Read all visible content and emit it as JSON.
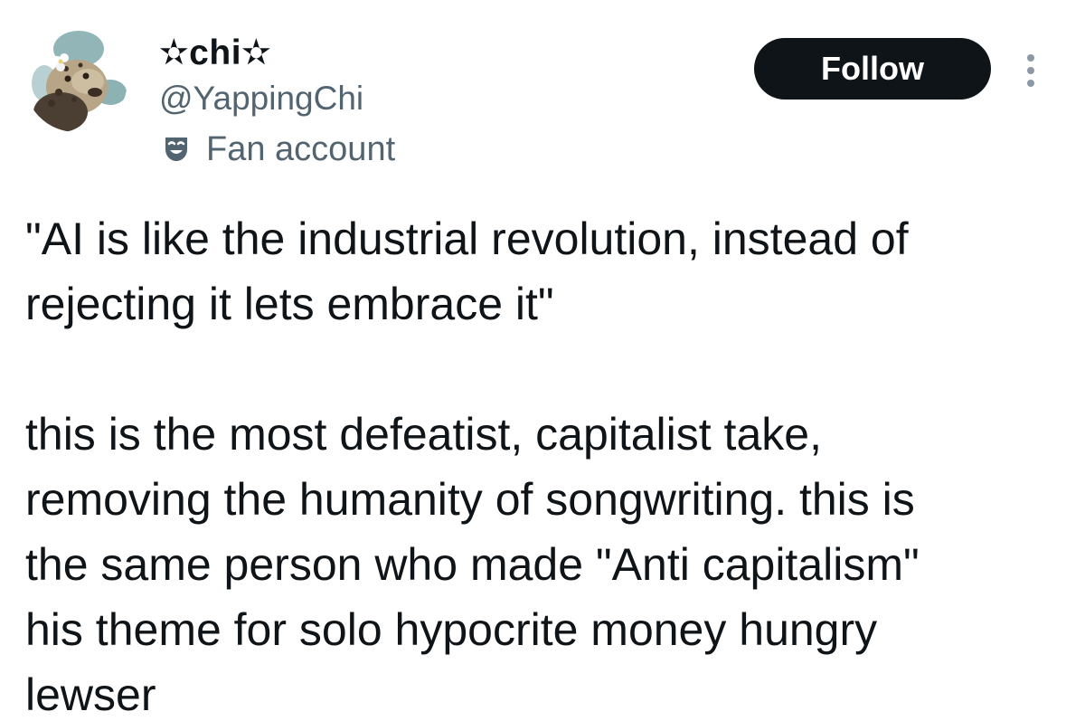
{
  "user": {
    "display_name": "✫chi✫",
    "handle": "@YappingChi",
    "affiliation_label": "Fan account",
    "affiliation_icon": "theater-mask-icon",
    "avatar_icon": "leopard-avatar"
  },
  "actions": {
    "follow_label": "Follow",
    "more_icon": "more-vertical-icon"
  },
  "tweet": {
    "text": "\"AI is like the industrial revolution, instead of\nrejecting it lets embrace it\"\n\nthis is the most defeatist, capitalist take,\nremoving the humanity of songwriting. this is\nthe same person who made \"Anti capitalism\"\nhis theme for solo hypocrite money hungry\nlewser"
  },
  "colors": {
    "text_primary": "#0f1419",
    "text_secondary": "#536471",
    "button_bg": "#0f1419",
    "button_text": "#ffffff"
  }
}
